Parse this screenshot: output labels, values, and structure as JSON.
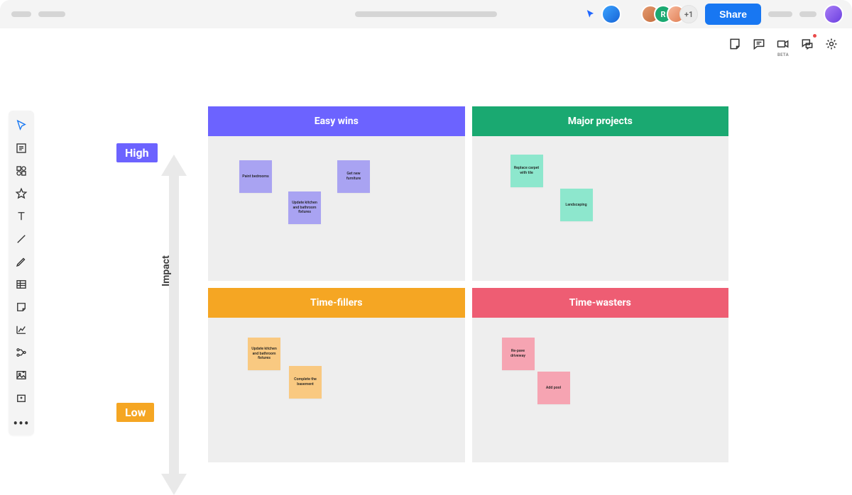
{
  "header": {
    "share_label": "Share",
    "overflow_avatar_label": "+1"
  },
  "subtoolbar": {
    "beta_label": "BETA"
  },
  "matrix": {
    "axis_label": "Impact",
    "high_label": "High",
    "low_label": "Low",
    "quadrants": {
      "easy_wins": {
        "title": "Easy wins"
      },
      "major_projects": {
        "title": "Major projects"
      },
      "time_fillers": {
        "title": "Time-fillers"
      },
      "time_wasters": {
        "title": "Time-wasters"
      }
    },
    "notes": {
      "paint_bedrooms": "Paint bedrooms",
      "get_furniture": "Get new furniture",
      "update_fixtures_1": "Update kitchen and bathroom fixtures",
      "replace_carpet": "Replace carpet with tile",
      "landscaping": "Landscaping",
      "update_fixtures_2": "Update kitchen and bathroom fixtures",
      "complete_basement": "Complete the basement",
      "repave_driveway": "Re-pave driveway",
      "add_pool": "Add pool"
    }
  }
}
